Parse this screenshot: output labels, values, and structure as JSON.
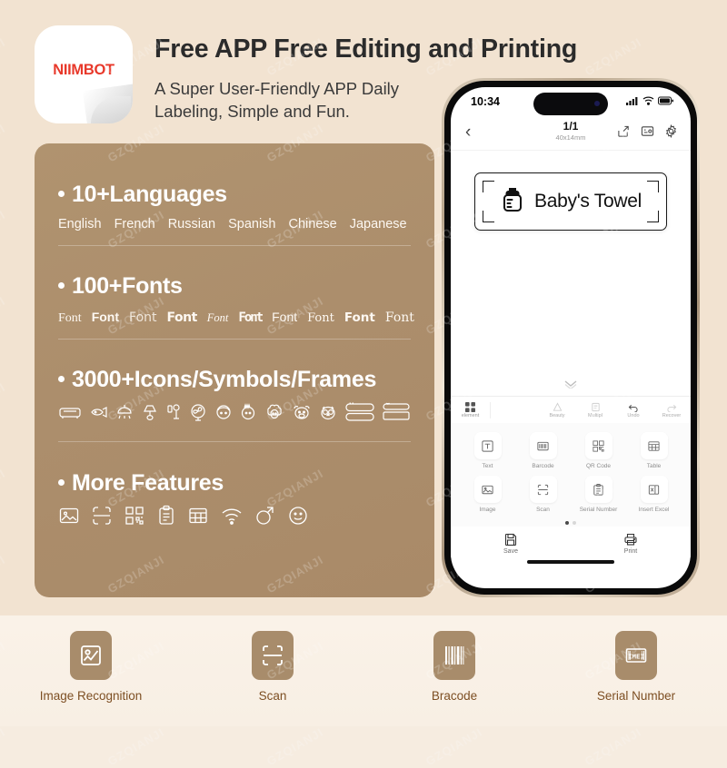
{
  "colors": {
    "page_bg": "#f2e3d1",
    "strip_bg": "#faf2e8",
    "card_bg": "#ac8e6c",
    "logo_red": "#e8392b",
    "strip_tile": "#a88c6b",
    "strip_text": "#7d4f23",
    "title_text": "#2b2b2b"
  },
  "watermark": {
    "text": "GZQIANJI"
  },
  "header": {
    "logo_text": "NIIMBOT",
    "title": "Free APP Free Editing and Printing",
    "subtitle": "A Super User-Friendly APP Daily Labeling, Simple and Fun."
  },
  "card": {
    "features": [
      {
        "title": "10+Languages",
        "items": [
          "English",
          "French",
          "Russian",
          "Spanish",
          "Chinese",
          "Japanese"
        ]
      },
      {
        "title": "100+Fonts",
        "items": [
          "Font",
          "Font",
          "Font",
          "Font",
          "Font",
          "Font",
          "Font",
          "Font",
          "Font",
          "Font"
        ]
      },
      {
        "title": "3000+Icons/Symbols/Frames",
        "icons": [
          "sofa-icon",
          "fish-icon",
          "pendant-lamp-icon",
          "table-lamp-icon",
          "floor-lamp-icon",
          "fan-icon",
          "boy-face-icon",
          "girl-face-icon",
          "sheep-face-icon",
          "cow-face-icon",
          "owl-face-icon",
          "frame-split-icon",
          "frame-label-icon"
        ]
      },
      {
        "title": "More Features",
        "icons": [
          "image-icon",
          "scan-icon",
          "qr-code-icon",
          "clipboard-icon",
          "table-icon",
          "wifi-icon",
          "rotate-icon",
          "smiley-icon"
        ]
      }
    ]
  },
  "phone": {
    "status": {
      "time": "10:34",
      "signal": "signal-icon",
      "wifi": "wifi-icon",
      "battery": "battery-icon"
    },
    "nav": {
      "back": "chevron-left-icon",
      "page": "1/1",
      "size": "40x14mm",
      "icons": [
        "share-icon",
        "template-icon",
        "gear-icon"
      ]
    },
    "canvas": {
      "label_text": "Baby's Towel",
      "label_icon": "baby-bottle-icon",
      "collapse": "chevron-down-icon"
    },
    "toolbar": {
      "left": {
        "label": "element",
        "icon": "grid-icon"
      },
      "right": [
        {
          "label": "Beauty",
          "icon": "beauty-icon"
        },
        {
          "label": "Multipl",
          "icon": "multiple-icon"
        },
        {
          "label": "Undo",
          "icon": "undo-icon"
        },
        {
          "label": "Recover",
          "icon": "redo-icon"
        }
      ]
    },
    "tools": [
      {
        "label": "Text",
        "icon": "text-icon"
      },
      {
        "label": "Barcode",
        "icon": "barcode-icon"
      },
      {
        "label": "QR Code",
        "icon": "qr-code-icon"
      },
      {
        "label": "Table",
        "icon": "table-icon"
      },
      {
        "label": "Image",
        "icon": "image-icon"
      },
      {
        "label": "Scan",
        "icon": "scan-icon"
      },
      {
        "label": "Serial Number",
        "icon": "serial-number-icon"
      },
      {
        "label": "Insert Excel",
        "icon": "excel-icon"
      }
    ],
    "pager": {
      "pages": 2,
      "active": 0
    },
    "bottom": [
      {
        "label": "Save",
        "icon": "save-icon"
      },
      {
        "label": "Print",
        "icon": "print-icon"
      }
    ]
  },
  "strip": {
    "items": [
      {
        "label": "Image Recognition",
        "icon": "image-recognition-icon"
      },
      {
        "label": "Scan",
        "icon": "scan-icon"
      },
      {
        "label": "Bracode",
        "icon": "barcode-icon"
      },
      {
        "label": "Serial Number",
        "icon": "imei-icon"
      }
    ]
  }
}
